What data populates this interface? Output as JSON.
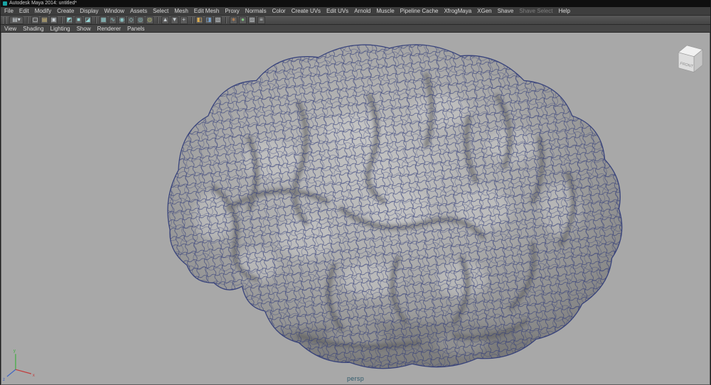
{
  "window": {
    "title": "Autodesk Maya 2014: untitled*"
  },
  "menu_bar": {
    "items": [
      {
        "name": "menu-file",
        "label": "File"
      },
      {
        "name": "menu-edit",
        "label": "Edit"
      },
      {
        "name": "menu-modify",
        "label": "Modify"
      },
      {
        "name": "menu-create",
        "label": "Create"
      },
      {
        "name": "menu-display",
        "label": "Display"
      },
      {
        "name": "menu-window",
        "label": "Window"
      },
      {
        "name": "menu-assets",
        "label": "Assets"
      },
      {
        "name": "menu-select",
        "label": "Select"
      },
      {
        "name": "menu-mesh",
        "label": "Mesh"
      },
      {
        "name": "menu-edit-mesh",
        "label": "Edit Mesh"
      },
      {
        "name": "menu-proxy",
        "label": "Proxy"
      },
      {
        "name": "menu-normals",
        "label": "Normals"
      },
      {
        "name": "menu-color",
        "label": "Color"
      },
      {
        "name": "menu-create-uvs",
        "label": "Create UVs"
      },
      {
        "name": "menu-edit-uvs",
        "label": "Edit UVs"
      },
      {
        "name": "menu-arnold",
        "label": "Arnold"
      },
      {
        "name": "menu-muscle",
        "label": "Muscle"
      },
      {
        "name": "menu-pipeline-cache",
        "label": "Pipeline Cache"
      },
      {
        "name": "menu-xfrogmaya",
        "label": "XfrogMaya"
      },
      {
        "name": "menu-xgen",
        "label": "XGen"
      },
      {
        "name": "menu-shave",
        "label": "Shave"
      },
      {
        "name": "menu-shave-select",
        "label": "Shave Select",
        "disabled": true
      },
      {
        "name": "menu-help",
        "label": "Help"
      }
    ]
  },
  "status_line": {
    "icons": [
      {
        "name": "menu-set-selector",
        "glyph": "▤▾",
        "color": "#cdd4d8",
        "wide": true
      },
      {
        "divider": true
      },
      {
        "name": "new-scene-icon",
        "glyph": "▢",
        "color": "#e4e8ea"
      },
      {
        "name": "open-scene-icon",
        "glyph": "▤",
        "color": "#d8c078"
      },
      {
        "name": "save-scene-icon",
        "glyph": "▣",
        "color": "#cdd4d8"
      },
      {
        "divider": true
      },
      {
        "name": "select-hierarchy-icon",
        "glyph": "◩",
        "color": "#96d6d6"
      },
      {
        "name": "select-object-icon",
        "glyph": "■",
        "color": "#96d6d6"
      },
      {
        "name": "select-component-icon",
        "glyph": "◪",
        "color": "#96d6d6"
      },
      {
        "divider": true
      },
      {
        "name": "snap-grid-icon",
        "glyph": "▦",
        "color": "#8fcfcf"
      },
      {
        "name": "snap-curve-icon",
        "glyph": "∿",
        "color": "#8fcfcf"
      },
      {
        "name": "snap-point-icon",
        "glyph": "◉",
        "color": "#8fcfcf"
      },
      {
        "name": "snap-plane-icon",
        "glyph": "◇",
        "color": "#8fcfcf"
      },
      {
        "name": "snap-view-icon",
        "glyph": "◎",
        "color": "#8fcfcf"
      },
      {
        "name": "make-live-icon",
        "glyph": "◍",
        "color": "#a8ad6e"
      },
      {
        "divider": true
      },
      {
        "name": "history-input-icon",
        "glyph": "▲",
        "color": "#c7cdd1"
      },
      {
        "name": "history-output-icon",
        "glyph": "▼",
        "color": "#c7cdd1"
      },
      {
        "name": "construction-history-icon",
        "glyph": "+",
        "color": "#c7cdd1"
      },
      {
        "divider": true
      },
      {
        "name": "render-icon",
        "glyph": "◧",
        "color": "#dfae4e"
      },
      {
        "name": "ipr-render-icon",
        "glyph": "◨",
        "color": "#78a6d4"
      },
      {
        "name": "render-settings-icon",
        "glyph": "▧",
        "color": "#c7cdd1"
      },
      {
        "divider": true
      },
      {
        "name": "paint-effects-icon",
        "glyph": "∗",
        "color": "#d08a4e"
      },
      {
        "name": "hypershade-icon",
        "glyph": "●",
        "color": "#7fc87f"
      },
      {
        "name": "uv-texture-editor-icon",
        "glyph": "▨",
        "color": "#c7cdd1"
      },
      {
        "name": "outliner-icon",
        "glyph": "≡",
        "color": "#c7cdd1"
      }
    ]
  },
  "panel_menu": {
    "items": [
      {
        "name": "panel-menu-view",
        "label": "View"
      },
      {
        "name": "panel-menu-shading",
        "label": "Shading"
      },
      {
        "name": "panel-menu-lighting",
        "label": "Lighting"
      },
      {
        "name": "panel-menu-show",
        "label": "Show"
      },
      {
        "name": "panel-menu-renderer",
        "label": "Renderer"
      },
      {
        "name": "panel-menu-panels",
        "label": "Panels"
      }
    ]
  },
  "viewport": {
    "camera_label": "persp",
    "viewcube_front_label": "FRONT",
    "axis": {
      "x": "x",
      "y": "y",
      "z": "z"
    },
    "scene_object": "polygon brain mesh with wireframe"
  },
  "colors": {
    "titlebar_bg": "#0f0f0f",
    "menubar_bg": "#3e3e3e",
    "panelmenu_bg": "#454545",
    "viewport_bg": "#a8a8a8",
    "wireframe": "#2e3a78",
    "axis_x": "#c23b3b",
    "axis_y": "#3fae3f",
    "axis_z": "#3b62c2"
  }
}
